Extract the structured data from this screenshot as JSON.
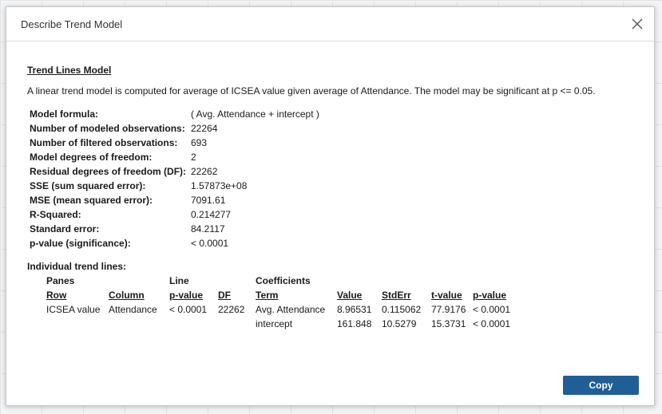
{
  "dialog": {
    "title": "Describe Trend Model",
    "copy_label": "Copy"
  },
  "model": {
    "heading": "Trend Lines Model",
    "description": "A linear trend model is computed for average of ICSEA value given average of Attendance.  The model may be significant at p <= 0.05.",
    "stats": [
      {
        "label": "Model formula:",
        "value": "( Avg. Attendance + intercept )"
      },
      {
        "label": "Number of modeled observations:",
        "value": "22264"
      },
      {
        "label": "Number of filtered observations:",
        "value": "693"
      },
      {
        "label": "Model degrees of freedom:",
        "value": "2"
      },
      {
        "label": "Residual degrees of freedom (DF):",
        "value": "22262"
      },
      {
        "label": "SSE (sum squared error):",
        "value": "1.57873e+08"
      },
      {
        "label": "MSE (mean squared error):",
        "value": "7091.61"
      },
      {
        "label": "R-Squared:",
        "value": "0.214277"
      },
      {
        "label": "Standard error:",
        "value": "84.2117"
      },
      {
        "label": "p-value (significance):",
        "value": "< 0.0001"
      }
    ]
  },
  "trend_lines": {
    "heading": "Individual trend lines:",
    "group_headers": {
      "panes": "Panes",
      "line": "Line",
      "coefficients": "Coefficients"
    },
    "columns": {
      "row": "Row",
      "column": "Column",
      "pvalue": "p-value",
      "df": "DF",
      "term": "Term",
      "value": "Value",
      "stderr": "StdErr",
      "tvalue": "t-value",
      "coef_pvalue": "p-value"
    },
    "rows": [
      {
        "row": "ICSEA value",
        "column": "Attendance",
        "pvalue": "< 0.0001",
        "df": "22262",
        "term": "Avg. Attendance",
        "value": "8.96531",
        "stderr": "0.115062",
        "tvalue": "77.9176",
        "coef_pvalue": "< 0.0001"
      },
      {
        "row": "",
        "column": "",
        "pvalue": "",
        "df": "",
        "term": "intercept",
        "value": "161.848",
        "stderr": "10.5279",
        "tvalue": "15.3731",
        "coef_pvalue": "< 0.0001"
      }
    ]
  }
}
